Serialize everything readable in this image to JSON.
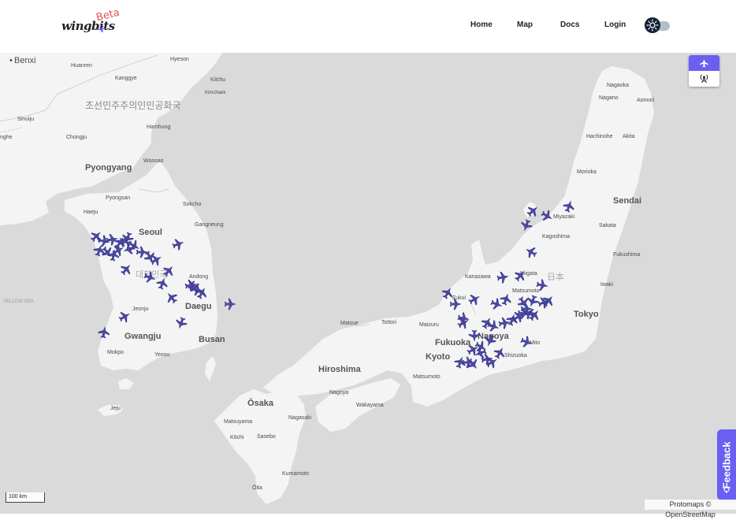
{
  "header": {
    "logo_text": "wingbits",
    "logo_badge": "Beta",
    "nav": [
      {
        "label": "Home"
      },
      {
        "label": "Map"
      },
      {
        "label": "Docs"
      },
      {
        "label": "Login"
      }
    ]
  },
  "controls": {
    "feedback_label": "Feedback",
    "scale_label": "100 km",
    "attribution": "Protomaps © OpenStreetMap"
  },
  "colors": {
    "accent": "#6b5ef3",
    "aircraft": "#4a49a8",
    "land": "#f4f4f4",
    "sea": "#dadada",
    "dark": "#132038"
  },
  "icons": {
    "aircraft_mode": "airplane-icon",
    "station_mode": "antenna-icon",
    "theme": "sun-icon",
    "feedback": "lightbulb-icon"
  },
  "map_labels": {
    "countries": [
      "조선민주주의인민공화국",
      "대한민국",
      "日本"
    ],
    "seas": [
      "YELLOW SEA"
    ],
    "major_cities": [
      "Pyongyang",
      "Seoul",
      "Daegu",
      "Gwangju",
      "Busan",
      "Hiroshima",
      "Fukuoka",
      "Kyoto",
      "Ōsaka",
      "Tokyo",
      "Sendai"
    ],
    "cities": [
      "Benxi",
      "Huanren",
      "Hyeson",
      "Kanggye",
      "Kilchu",
      "Kimchaek",
      "Sinuiju",
      "Hamhung",
      "Chongju",
      "Wonsan",
      "Pyongsan",
      "Haeju",
      "Sokcho",
      "Gangneung",
      "Andong",
      "Jeonju",
      "Mokpo",
      "Yeosu",
      "Jeju",
      "Matsue",
      "Tottori",
      "Maizuru",
      "Kanazawa",
      "Matsumoto",
      "Nagoya",
      "Wakayama",
      "Matsuyama",
      "Kōchi",
      "Sasebo",
      "Nagasaki",
      "Kumamoto",
      "Ōita",
      "Miyazaki",
      "Kagoshima",
      "Niigata",
      "Nagaoka",
      "Nagano",
      "Aomori",
      "Hirosaki",
      "Hachinohe",
      "Akita",
      "Morioka",
      "Sakata",
      "Fukushima",
      "Iwaki",
      "Mito",
      "Shizuoka",
      "Hamamatsu",
      "Gifu",
      "Fukui"
    ],
    "partial": [
      "nghe"
    ]
  },
  "aircraft_count": 80
}
